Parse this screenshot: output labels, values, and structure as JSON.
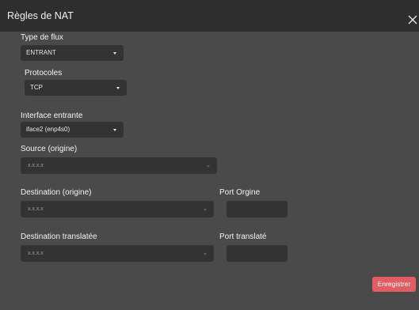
{
  "dialog": {
    "title": "Règles de NAT"
  },
  "form": {
    "flow_type": {
      "label": "Type de flux",
      "value": "ENTRANT"
    },
    "protocols": {
      "label": "Protocoles",
      "value": "TCP"
    },
    "incoming_interface": {
      "label": "Interface entrante",
      "value": "iface2 (enp4s0)"
    },
    "source": {
      "label": "Source (origine)",
      "placeholder": "x.x.x.x"
    },
    "destination": {
      "label": "Destination (origine)",
      "placeholder": "x.x.x.x"
    },
    "origin_port": {
      "label": "Port Orgine",
      "value": ""
    },
    "translated_destination": {
      "label": "Destination translatée",
      "placeholder": "x.x.x.x"
    },
    "translated_port": {
      "label": "Port translaté",
      "value": ""
    }
  },
  "actions": {
    "save_label": "Enregistrer"
  },
  "colors": {
    "background": "#4a4a4a",
    "titlebar": "#2e2e2e",
    "field": "#333333",
    "accent": "#e25c64"
  }
}
